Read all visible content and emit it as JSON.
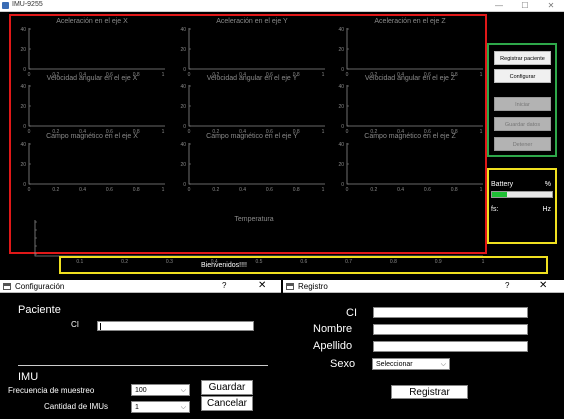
{
  "main": {
    "title": "IMU-9255",
    "minimize": "—",
    "maximize": "☐",
    "close": "✕",
    "plots": [
      {
        "title": "Aceleración en el eje X"
      },
      {
        "title": "Aceleración en el eje Y"
      },
      {
        "title": "Aceleración en el eje Z"
      },
      {
        "title": "Velocidad angular en el eje X"
      },
      {
        "title": "Velocidad angular en el eje Y"
      },
      {
        "title": "Velocidad angular en el eje Z"
      },
      {
        "title": "Campo magnético en el eje X"
      },
      {
        "title": "Campo magnético en el eje Y"
      },
      {
        "title": "Campo magnético en el eje Z"
      }
    ],
    "plot_yticks": [
      "40",
      "20",
      "0"
    ],
    "plot_xticks": [
      "0",
      "0.2",
      "0.4",
      "0.6",
      "0.8",
      "1"
    ],
    "temperature": {
      "title": "Temperatura",
      "xticks": [
        "0",
        "0.1",
        "0.2",
        "0.3",
        "0.4",
        "0.5",
        "0.6",
        "0.7",
        "0.8",
        "0.9",
        "1"
      ]
    },
    "buttons": {
      "registrar_paciente": "Registrar paciente",
      "configurar": "Configurar",
      "iniciar": "Iniciar",
      "guardar_datos": "Guardar datos",
      "detener": "Detener"
    },
    "battery": {
      "label": "Battery",
      "unit": "%",
      "level": 0.25,
      "level_color": "#1fbf35",
      "fs_label": "fs:",
      "hz_label": "Hz"
    },
    "status": "Bienvenidos!!!!",
    "colors": {
      "plots_border": "#e01818",
      "controls_border": "#2ea84a",
      "status_border": "#f0e020"
    }
  },
  "config_dialog": {
    "title": "Configuración",
    "help": "?",
    "close": "✕",
    "paciente_heading": "Paciente",
    "ci_label": "CI",
    "ci_value": "",
    "imu_heading": "IMU",
    "frecuencia_label": "Frecuencia de muestreo",
    "frecuencia_value": "100",
    "cantidad_label": "Cantidad de IMUs",
    "cantidad_value": "1",
    "guardar": "Guardar",
    "cancelar": "Cancelar"
  },
  "registro_dialog": {
    "title": "Registro",
    "help": "?",
    "close": "✕",
    "ci_label": "CI",
    "nombre_label": "Nombre",
    "apellido_label": "Apellido",
    "sexo_label": "Sexo",
    "sexo_value": "Seleccionar",
    "registrar": "Registrar"
  }
}
